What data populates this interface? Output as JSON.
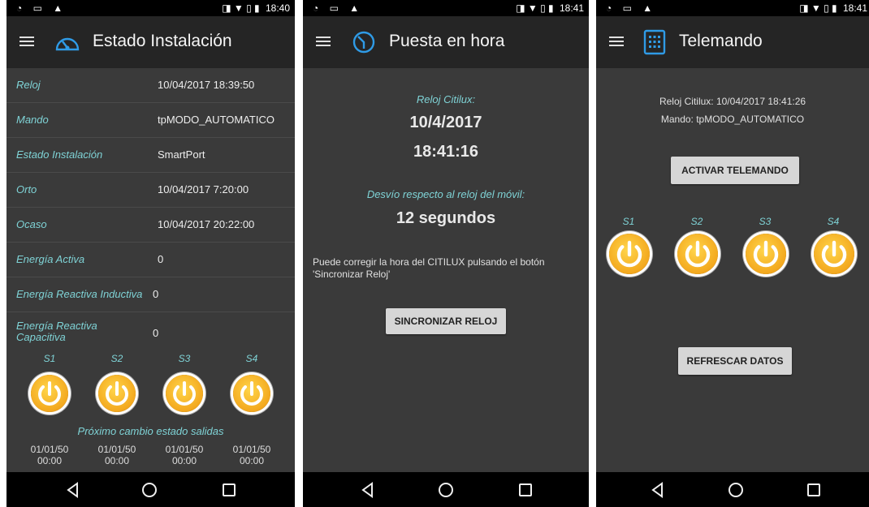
{
  "status": {
    "left_icons": "◔ ▭ ▲",
    "right_icons": "◨ ▼ ▯ ▮",
    "times": [
      "18:40",
      "18:41",
      "18:41"
    ]
  },
  "screen1": {
    "title": "Estado Instalación",
    "icon": "gauge-icon",
    "rows": [
      {
        "key": "Reloj",
        "value": "10/04/2017 18:39:50"
      },
      {
        "key": "Mando",
        "value": "tpMODO_AUTOMATICO"
      },
      {
        "key": "Estado Instalación",
        "value": "SmartPort"
      },
      {
        "key": "Orto",
        "value": "10/04/2017 7:20:00"
      },
      {
        "key": "Ocaso",
        "value": "10/04/2017 20:22:00"
      },
      {
        "key": "Energía Activa",
        "value": "0"
      },
      {
        "key": "Energía Reactiva Inductiva",
        "value": "0"
      },
      {
        "key": "Energía Reactiva Capacitiva",
        "value": "0"
      }
    ],
    "switches": [
      "S1",
      "S2",
      "S3",
      "S4"
    ],
    "next_change_label": "Próximo cambio estado salidas",
    "next_changes": [
      {
        "date": "01/01/50",
        "time": "00:00"
      },
      {
        "date": "01/01/50",
        "time": "00:00"
      },
      {
        "date": "01/01/50",
        "time": "00:00"
      },
      {
        "date": "01/01/50",
        "time": "00:00"
      }
    ]
  },
  "screen2": {
    "title": "Puesta en hora",
    "icon": "clock-icon",
    "clock_label": "Reloj Citilux:",
    "date": "10/4/2017",
    "time": "18:41:16",
    "deviation_label": "Desvío respecto al reloj del móvil:",
    "deviation": "12 segundos",
    "info": "Puede corregir la hora del CITILUX pulsando el botón 'Sincronizar Reloj'",
    "sync_button": "SINCRONIZAR RELOJ"
  },
  "screen3": {
    "title": "Telemando",
    "icon": "keypad-icon",
    "clock_line": "Reloj Citilux: 10/04/2017 18:41:26",
    "mode_line": "Mando: tpMODO_AUTOMATICO",
    "activate_button": "ACTIVAR TELEMANDO",
    "switches": [
      "S1",
      "S2",
      "S3",
      "S4"
    ],
    "refresh_button": "REFRESCAR DATOS"
  },
  "nav": {
    "back": "back-icon",
    "home": "home-icon",
    "recents": "recents-icon"
  },
  "colors": {
    "accent": "#7fd3d6",
    "background": "#3a3a3a",
    "appbar": "#252525",
    "power": "#f3a81e"
  }
}
